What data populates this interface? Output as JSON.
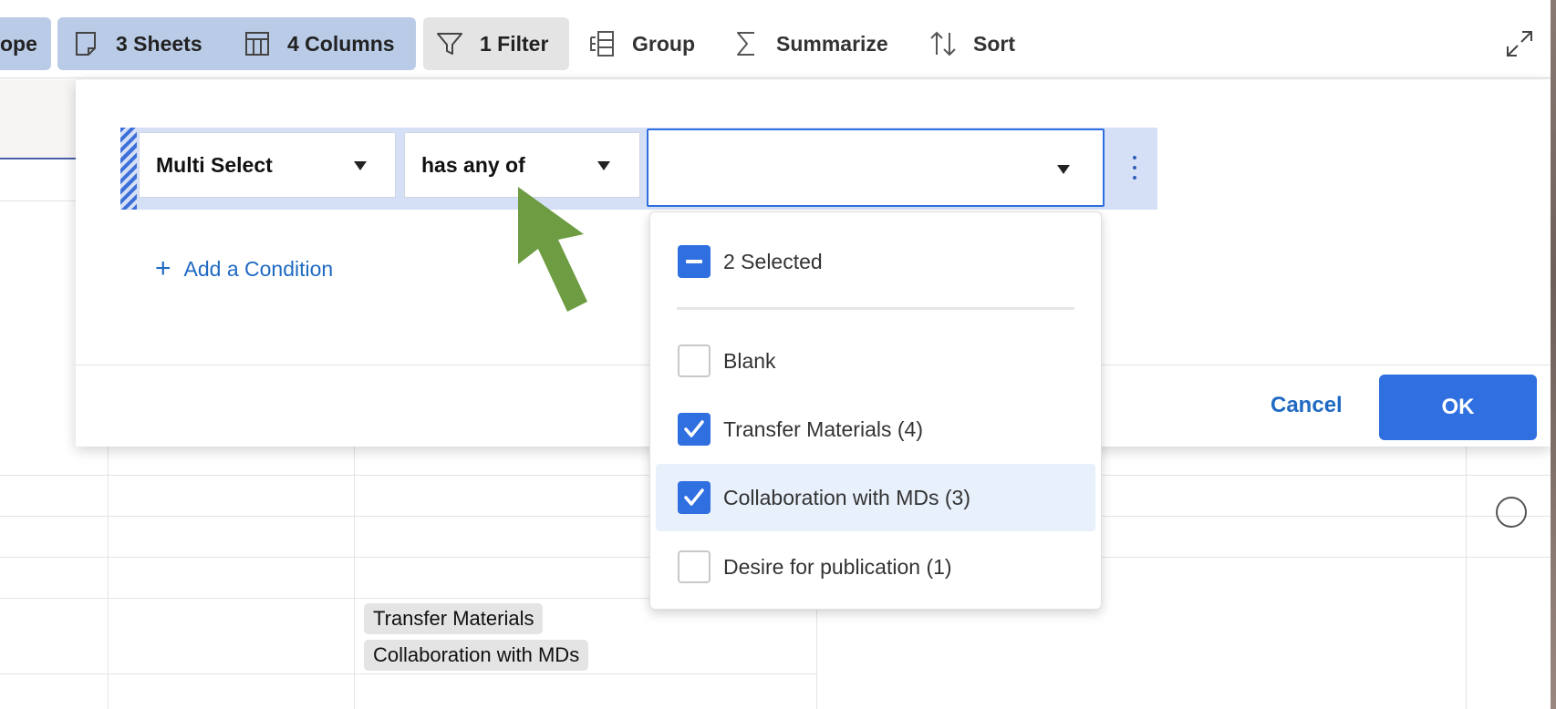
{
  "toolbar": {
    "scope_partial": "ope",
    "sheets_label": "3 Sheets",
    "columns_label": "4 Columns",
    "filter_label": "1 Filter",
    "group_label": "Group",
    "summarize_label": "Summarize",
    "sort_label": "Sort",
    "icons": {
      "sheets": "sheet-icon",
      "columns": "columns-icon",
      "filter": "funnel-icon",
      "group": "group-icon",
      "summarize": "sigma-icon",
      "sort": "sort-arrows-icon",
      "expand": "expand-icon"
    }
  },
  "filter_panel": {
    "condition": {
      "field": "Multi Select",
      "operator": "has any of",
      "value": ""
    },
    "add_condition_label": "Add a Condition",
    "cancel_label": "Cancel",
    "ok_label": "OK"
  },
  "dropdown": {
    "summary_label": "2 Selected",
    "options": [
      {
        "label": "Blank",
        "checked": false
      },
      {
        "label": "Transfer Materials (4)",
        "checked": true
      },
      {
        "label": "Collaboration with MDs (3)",
        "checked": true
      },
      {
        "label": "Desire for publication (1)",
        "checked": false
      }
    ]
  },
  "grid": {
    "tags": [
      "Transfer Materials",
      "Collaboration with MDs"
    ]
  },
  "colors": {
    "accent": "#2f6fe0",
    "link": "#1f6ac2",
    "chip_blue": "#b9cbe6",
    "chip_grey": "#e4e4e4",
    "condition_row": "#d5e0f6",
    "annotation_arrow": "#6e9c42"
  }
}
